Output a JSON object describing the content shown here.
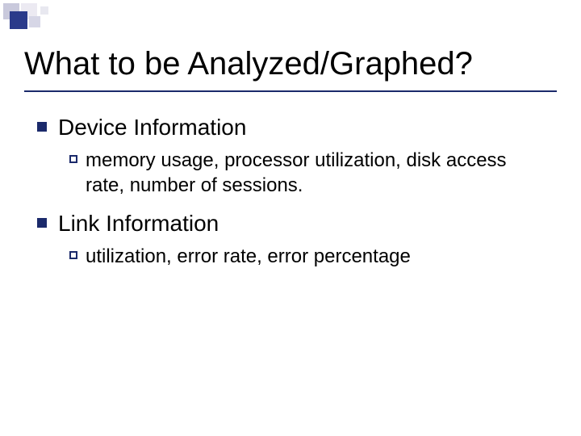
{
  "title": "What to be Analyzed/Graphed?",
  "items": [
    {
      "label": "Device Information",
      "sub": [
        {
          "label": "memory usage, processor utilization, disk access rate, number of sessions."
        }
      ]
    },
    {
      "label": "Link Information",
      "sub": [
        {
          "label": "utilization, error rate, error percentage"
        }
      ]
    }
  ]
}
